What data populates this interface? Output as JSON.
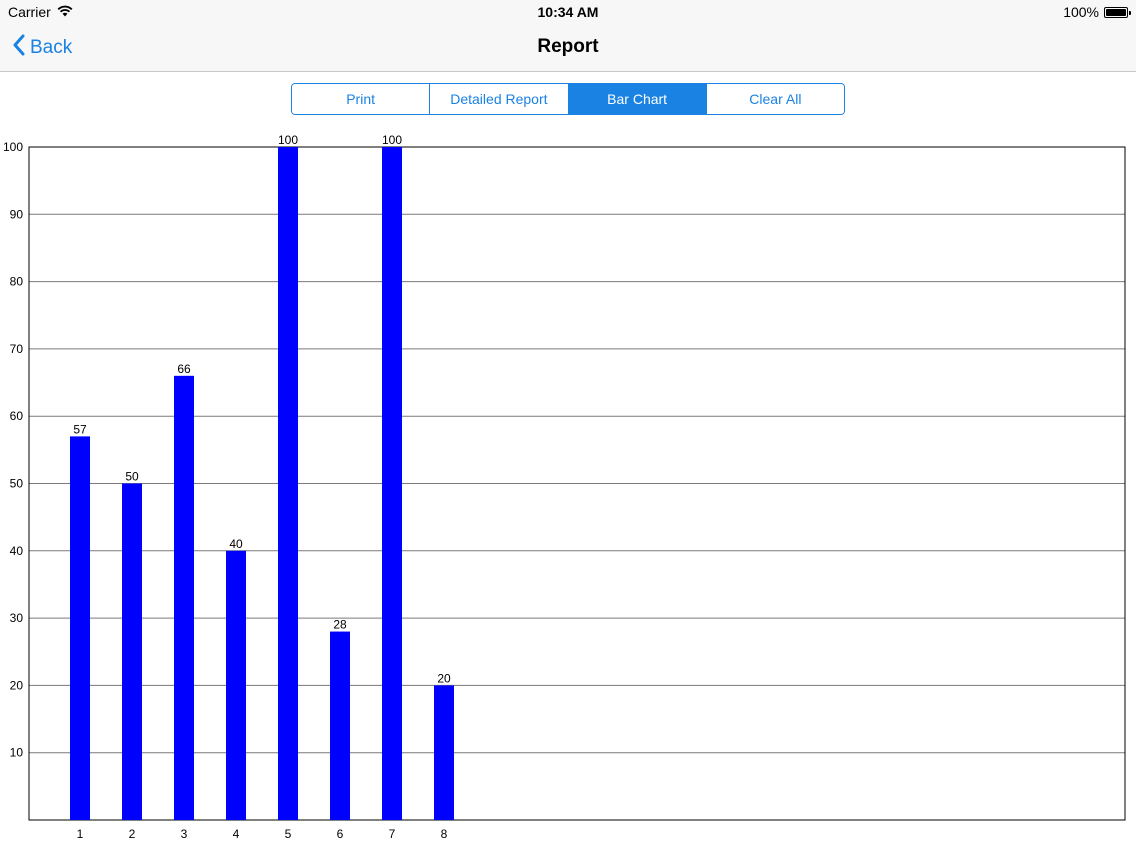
{
  "status": {
    "carrier": "Carrier",
    "time": "10:34 AM",
    "battery": "100%",
    "wifi_icon": "wifi-icon",
    "battery_icon": "battery-icon"
  },
  "nav": {
    "back_label": "Back",
    "back_icon": "chevron-left-icon",
    "title": "Report"
  },
  "segments": [
    {
      "label": "Print",
      "selected": false
    },
    {
      "label": "Detailed Report",
      "selected": false
    },
    {
      "label": "Bar Chart",
      "selected": true
    },
    {
      "label": "Clear All",
      "selected": false
    }
  ],
  "colors": {
    "accent": "#1a82e2",
    "bar": "#0000ff"
  },
  "chart_data": {
    "type": "bar",
    "title": "",
    "xlabel": "",
    "ylabel": "",
    "categories": [
      "1",
      "2",
      "3",
      "4",
      "5",
      "6",
      "7",
      "8"
    ],
    "values": [
      57,
      50,
      66,
      40,
      100,
      28,
      100,
      20
    ],
    "ylim": [
      0,
      100
    ],
    "yticks": [
      10,
      20,
      30,
      40,
      50,
      60,
      70,
      80,
      90,
      100
    ],
    "grid": true,
    "data_labels": true,
    "bar_color": "#0000ff"
  }
}
